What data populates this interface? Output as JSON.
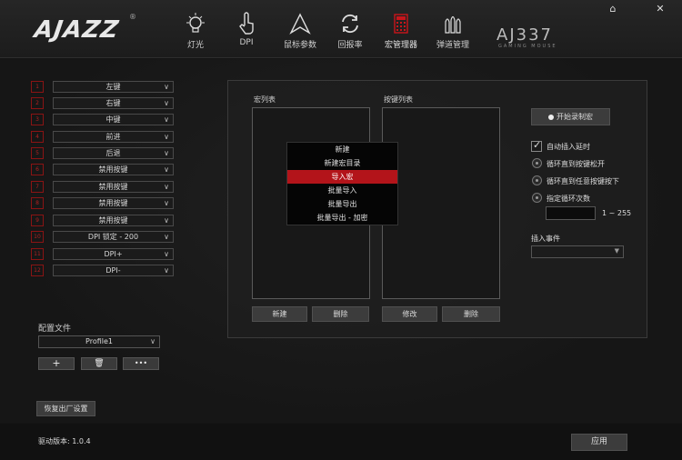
{
  "brand": {
    "logo": "AJAZZ",
    "reg": "®",
    "model": "AJ337",
    "model_sub": "GAMING MOUSE"
  },
  "nav": [
    {
      "label": "灯光",
      "icon": "bulb-icon"
    },
    {
      "label": "DPI",
      "icon": "hand-pointer-icon"
    },
    {
      "label": "鼠标参数",
      "icon": "cursor-arrow-icon"
    },
    {
      "label": "回报率",
      "icon": "refresh-icon"
    },
    {
      "label": "宏管理器",
      "icon": "calculator-icon"
    },
    {
      "label": "弹道管理",
      "icon": "bullets-icon"
    }
  ],
  "window": {
    "home_icon": "⌂",
    "close_icon": "✕"
  },
  "keys": [
    {
      "num": "1",
      "label": "左键"
    },
    {
      "num": "2",
      "label": "右键"
    },
    {
      "num": "3",
      "label": "中键"
    },
    {
      "num": "4",
      "label": "前进"
    },
    {
      "num": "5",
      "label": "后退"
    },
    {
      "num": "6",
      "label": "禁用按键"
    },
    {
      "num": "7",
      "label": "禁用按键"
    },
    {
      "num": "8",
      "label": "禁用按键"
    },
    {
      "num": "9",
      "label": "禁用按键"
    },
    {
      "num": "10",
      "label": "DPI 锁定 - 200"
    },
    {
      "num": "11",
      "label": "DPI+"
    },
    {
      "num": "12",
      "label": "DPI-"
    }
  ],
  "profile": {
    "label": "配置文件",
    "selected": "Profile1",
    "add": "+",
    "delete": "🗑",
    "more": "•••"
  },
  "restore_button": "恢复出厂设置",
  "macro_panel": {
    "macro_list_label": "宏列表",
    "key_list_label": "按键列表",
    "new_button": "新建",
    "delete_button": "删除",
    "modify_button": "修改",
    "delete_button_2": "删除",
    "context_menu": [
      "新建",
      "新建宏目录",
      "导入宏",
      "批量导入",
      "批量导出",
      "批量导出 - 加密"
    ],
    "record_button": "开始录制宏",
    "auto_delay": "自动插入延时",
    "loop_options": [
      "循环直到按键松开",
      "循环直到任意按键按下",
      "指定循环次数"
    ],
    "loop_range": "1 ~ 255",
    "insert_event_label": "插入事件"
  },
  "footer": {
    "version": "驱动版本: 1.0.4",
    "apply_button": "应用"
  },
  "colors": {
    "accent": "#b3141a",
    "background": "#141414"
  }
}
